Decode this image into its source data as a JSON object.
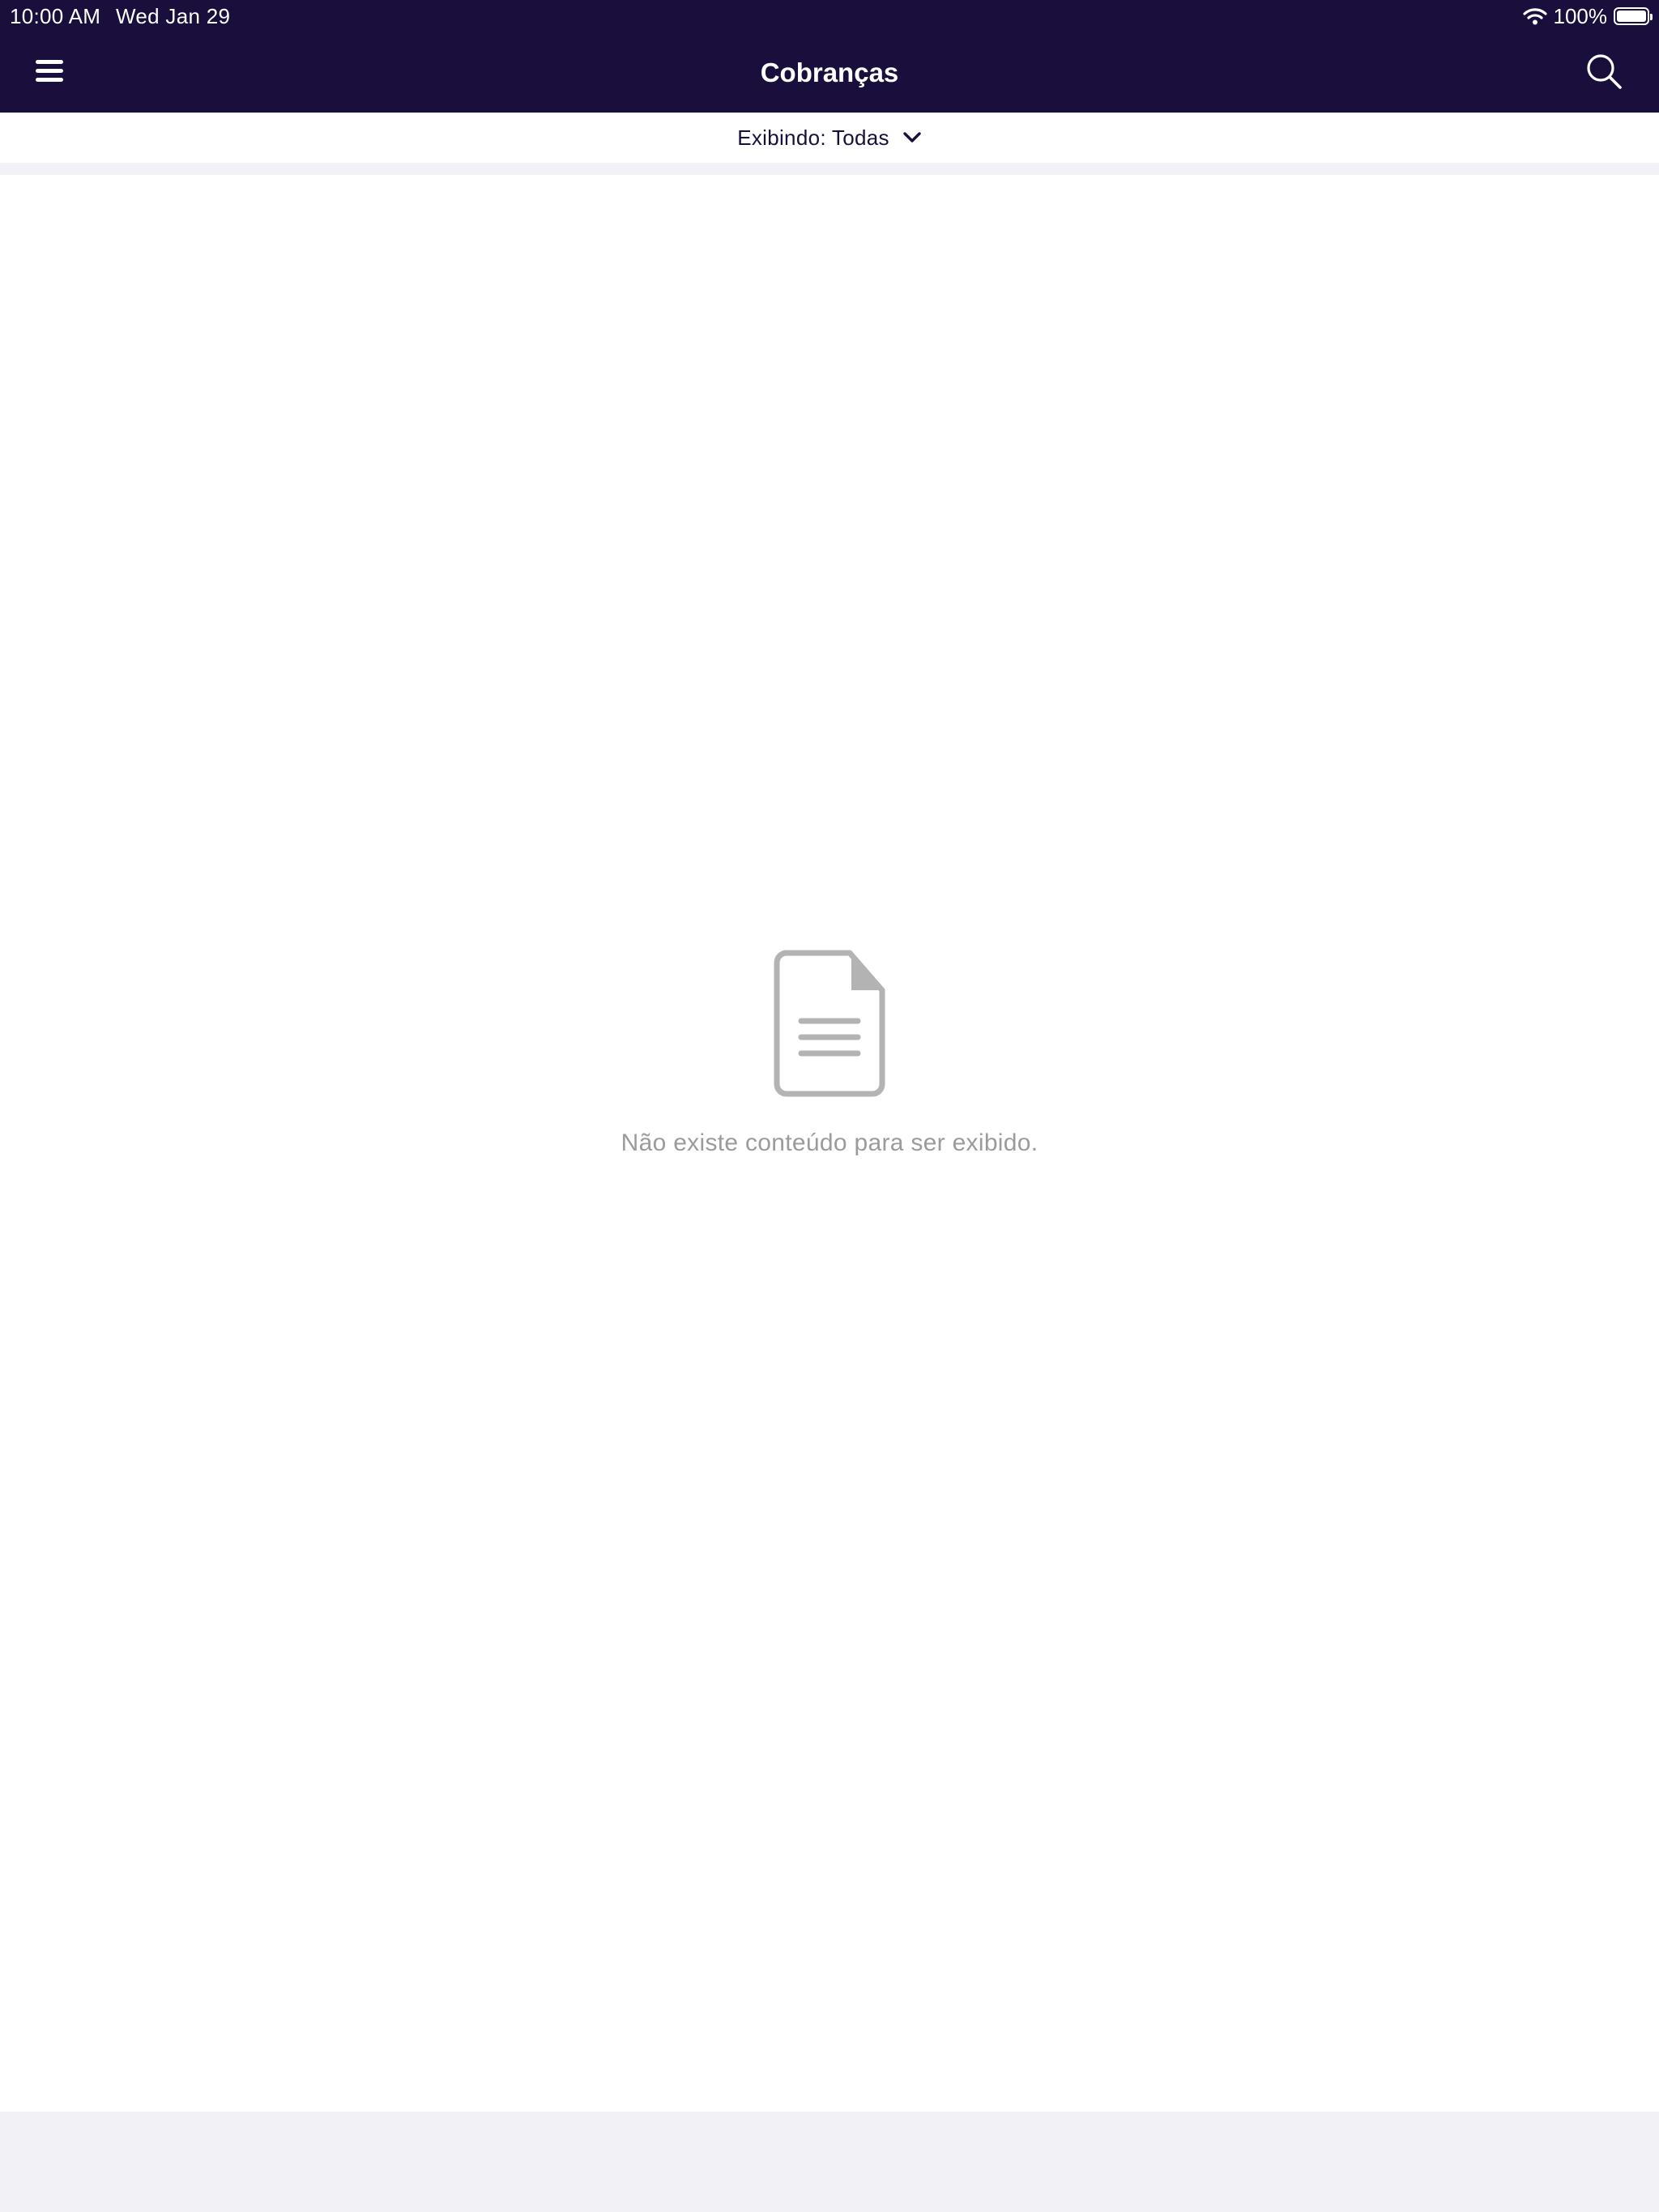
{
  "status_bar": {
    "time": "10:00 AM",
    "date": "Wed Jan 29",
    "battery": "100%",
    "icons": [
      "wifi-icon",
      "battery-icon"
    ]
  },
  "header": {
    "title": "Cobranças",
    "menu_icon": "hamburger-menu-icon",
    "search_icon": "search-icon",
    "background_color": "#1a0f3c"
  },
  "filter": {
    "label": "Exibindo: Todas",
    "icon": "chevron-down-icon"
  },
  "empty_state": {
    "icon": "document-icon",
    "message": "Não existe conteúdo para ser exibido."
  }
}
